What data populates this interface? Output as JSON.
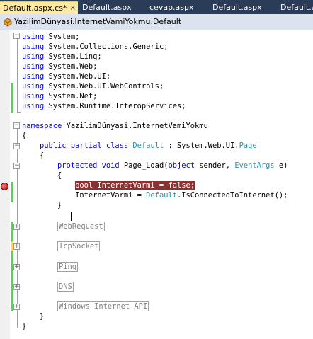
{
  "tabs": [
    {
      "label": "Default.aspx.cs*",
      "active": true
    },
    {
      "label": "Default.aspx",
      "active": false
    },
    {
      "label": "cevap.aspx",
      "active": false
    },
    {
      "label": "Default.aspx",
      "active": false
    },
    {
      "label": "Default.a",
      "active": false
    }
  ],
  "tab_close_glyph": "×",
  "navbar": {
    "icon": "class-icon",
    "text": "YazilimDünyasi.InternetVamiYokmu.Default"
  },
  "code": {
    "using_kw": "using",
    "usings": [
      "System;",
      "System.Collections.Generic;",
      "System.Linq;",
      "System.Web;",
      "System.Web.UI;",
      "System.Web.UI.WebControls;",
      "System.Net;",
      "System.Runtime.InteropServices;"
    ],
    "namespace_kw": "namespace",
    "namespace_name": "YazilimDünyasi.InternetVamiYokmu",
    "open_brace": "{",
    "close_brace": "}",
    "class_modifiers": "public partial class",
    "class_name": "Default",
    "class_sep": " : System.Web.UI.",
    "class_base": "Page",
    "method_modifiers": "protected void",
    "method_name": " Page_Load(",
    "param1_type": "object",
    "param1_name": " sender, ",
    "param2_type": "EventArgs",
    "param2_name": " e)",
    "breakpoint_stmt": "bool InternetVarmi = false;",
    "stmt2_pre": "InternetVarmi = ",
    "stmt2_type": "Default",
    "stmt2_post": ".IsConnectedToInternet();",
    "regions": [
      "WebRequest",
      "TcpSocket",
      "Ping",
      "DNS",
      "Windows Internet API"
    ]
  },
  "colors": {
    "keyword": "#0000ff",
    "type": "#2b91af",
    "breakpoint": "#8a3232",
    "changed_saved": "#6bc46b",
    "changed_unsaved": "#f7d66a"
  }
}
